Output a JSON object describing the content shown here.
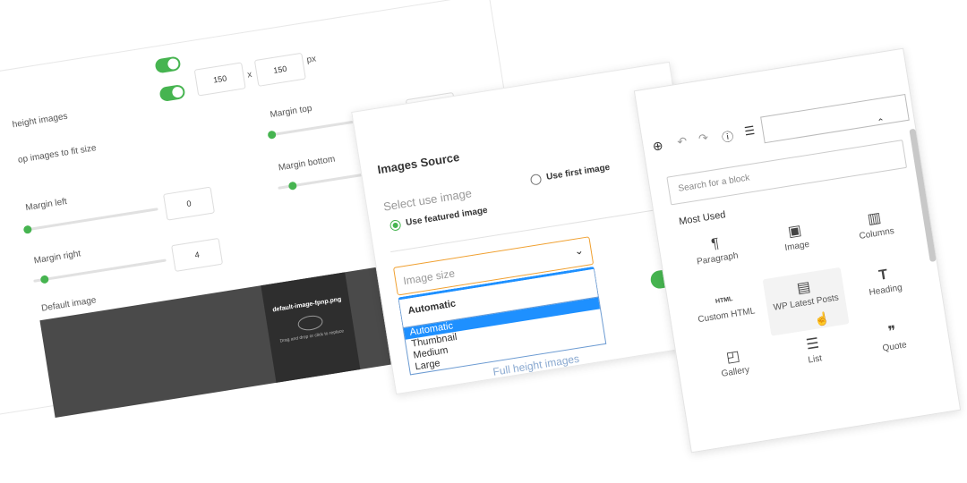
{
  "settings": {
    "dimension_w": "150",
    "dimension_sep": "x",
    "dimension_h": "150",
    "dimension_unit": "px",
    "full_height_label": "height images",
    "crop_label": "op images to fit size",
    "margin_top_label": "Margin top",
    "margin_top_value": "0",
    "margin_left_label": "Margin left",
    "margin_left_value": "0",
    "margin_bottom_label": "Margin bottom",
    "margin_bottom_value": "4",
    "margin_right_label": "Margin right",
    "margin_right_value": "4",
    "default_image_label": "Default image",
    "file_name": "default-image-fpnp.png",
    "drop_hint": "Drag and drop or click to replace",
    "accent": "#46b450"
  },
  "images_source": {
    "title": "Images Source",
    "select_label": "Select use image",
    "option_featured": "Use featured image",
    "option_first": "Use first image",
    "size_label": "Image size",
    "selected": "Automatic",
    "options": [
      "Automatic",
      "Thumbnail",
      "Medium",
      "Large"
    ],
    "behind_text": "Full height images"
  },
  "inserter": {
    "search_placeholder": "Search for a block",
    "section": "Most Used",
    "blocks": [
      {
        "label": "Paragraph",
        "icon": "¶"
      },
      {
        "label": "Image",
        "icon": "▣"
      },
      {
        "label": "Columns",
        "icon": "▥"
      },
      {
        "label": "Custom HTML",
        "icon": "HTML"
      },
      {
        "label": "WP Latest Posts",
        "icon": "▤"
      },
      {
        "label": "Heading",
        "icon": "T"
      },
      {
        "label": "Gallery",
        "icon": "◰"
      },
      {
        "label": "List",
        "icon": "☰"
      },
      {
        "label": "Quote",
        "icon": "❞"
      }
    ]
  }
}
